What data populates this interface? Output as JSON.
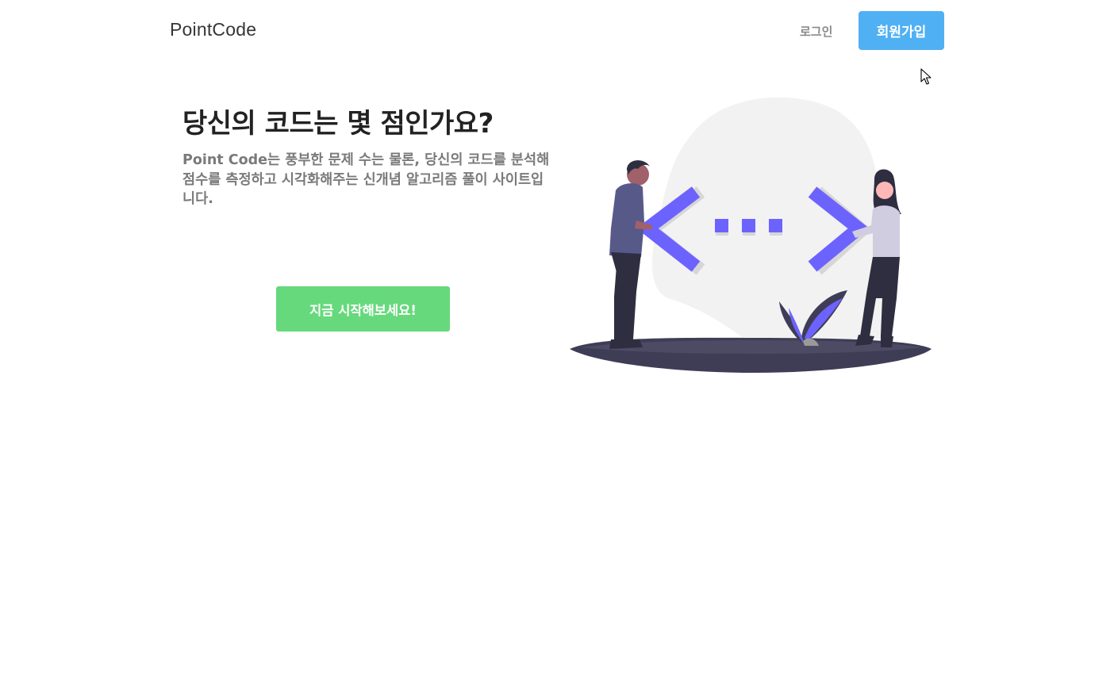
{
  "navbar": {
    "brand": "PointCode",
    "login_label": "로그인",
    "signup_label": "회원가입"
  },
  "hero": {
    "title": "당신의 코드는 몇 점인가요?",
    "description": "Point Code는 풍부한 문제 수는 물론, 당신의 코드를 분석해 점수를 측정하고 시각화해주는 신개념 알고리즘 풀이 사이트입니다.",
    "cta_label": "지금 시작해보세요!"
  },
  "colors": {
    "signup_button": "#4fb0f4",
    "cta_button": "#66d97c",
    "illustration_accent": "#6c63ff",
    "ground_shadow": "#3f3d56"
  },
  "icons": {
    "cursor": "mouse-pointer-icon",
    "illustration": "people-coding-illustration"
  }
}
